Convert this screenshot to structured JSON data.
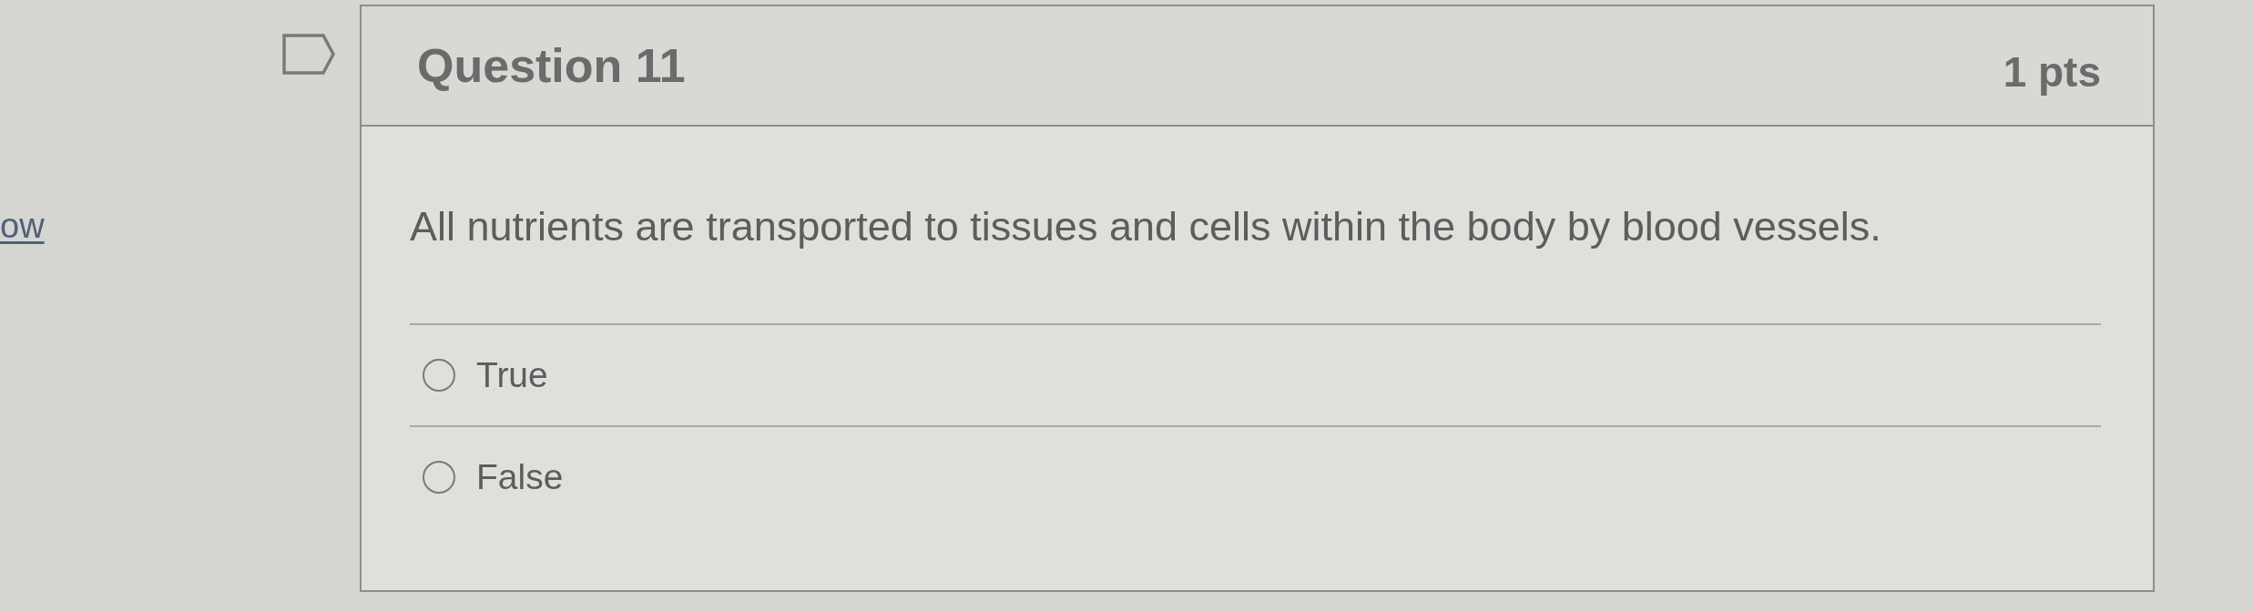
{
  "side_link": {
    "text": "ow"
  },
  "question": {
    "flagged": false,
    "title": "Question 11",
    "points": "1 pts",
    "text": "All nutrients are transported to tissues and cells within the body by blood vessels.",
    "answers": [
      {
        "label": "True",
        "selected": false
      },
      {
        "label": "False",
        "selected": false
      }
    ]
  }
}
